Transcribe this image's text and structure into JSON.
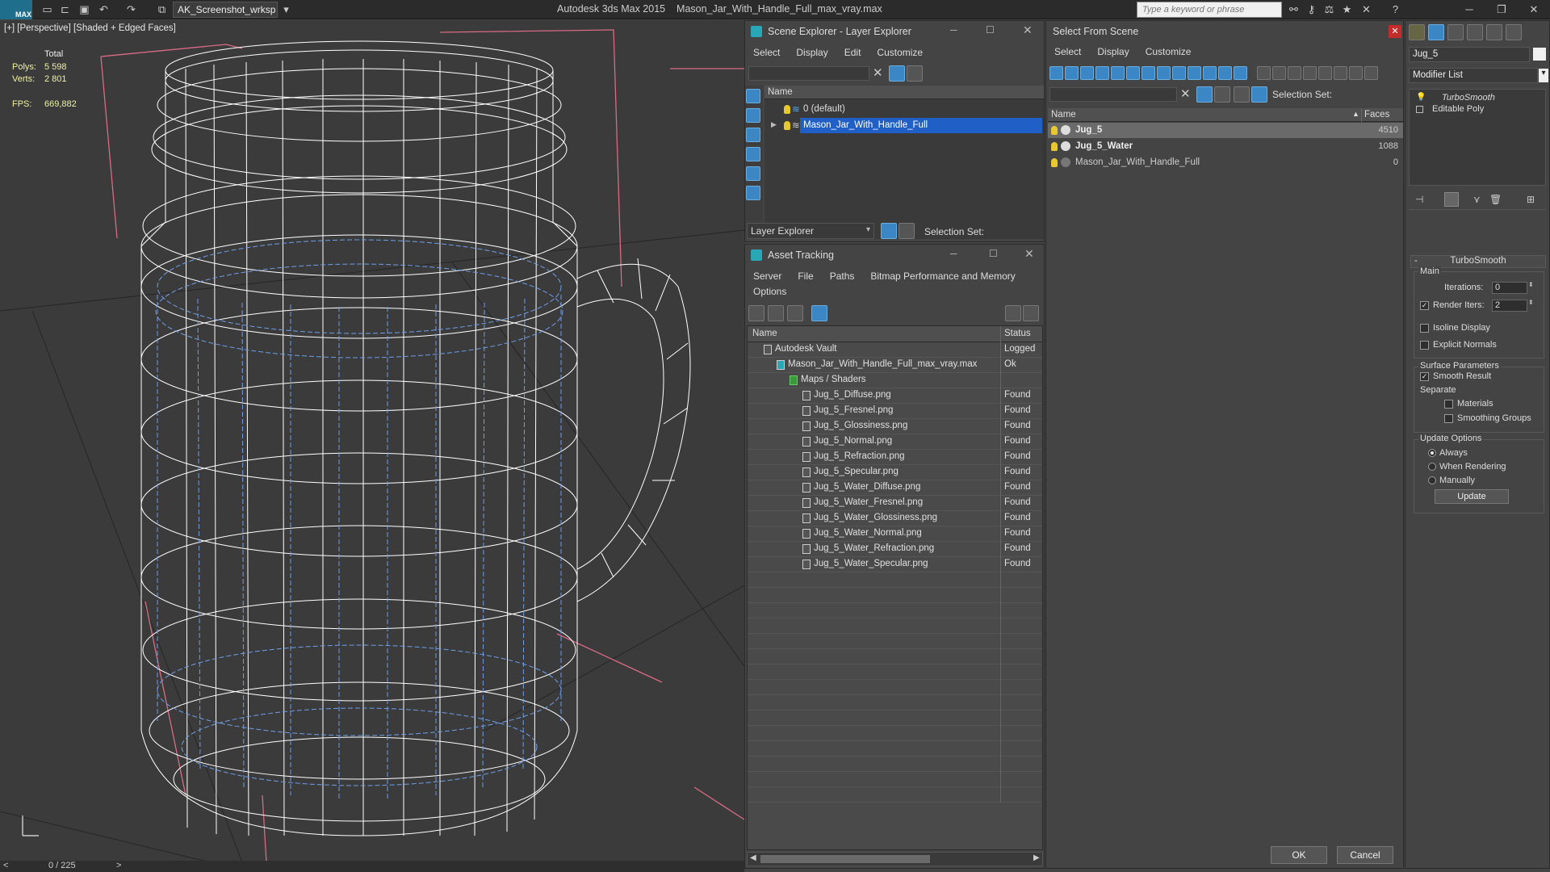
{
  "titlebar": {
    "logo": "MAX",
    "workspace": "AK_Screenshot_wrksp",
    "app": "Autodesk 3ds Max  2015",
    "file": "Mason_Jar_With_Handle_Full_max_vray.max",
    "search_placeholder": "Type a keyword or phrase"
  },
  "viewport": {
    "label": "[+] [Perspective] [Shaded + Edged Faces]",
    "stats": {
      "total": "Total",
      "polys_label": "Polys:",
      "polys": "5 598",
      "verts_label": "Verts:",
      "verts": "2 801",
      "fps_label": "FPS:",
      "fps": "669,882"
    },
    "timeline": "0 / 225",
    "prev": "<",
    "next": ">"
  },
  "scene_explorer": {
    "title": "Scene Explorer - Layer Explorer",
    "menu": [
      "Select",
      "Display",
      "Edit",
      "Customize"
    ],
    "col_name": "Name",
    "layers": [
      {
        "name": "0 (default)",
        "selected": false
      },
      {
        "name": "Mason_Jar_With_Handle_Full",
        "selected": true
      }
    ],
    "footer_dropdown": "Layer Explorer",
    "selection_set": "Selection Set:"
  },
  "asset_tracking": {
    "title": "Asset Tracking",
    "menu": [
      "Server",
      "File",
      "Paths",
      "Bitmap Performance and Memory"
    ],
    "menu2": [
      "Options"
    ],
    "col_name": "Name",
    "col_status": "Status",
    "rows": [
      {
        "name": "Autodesk Vault",
        "status": "Logged",
        "indent": 0
      },
      {
        "name": "Mason_Jar_With_Handle_Full_max_vray.max",
        "status": "Ok",
        "indent": 1
      },
      {
        "name": "Maps / Shaders",
        "status": "",
        "indent": 2
      },
      {
        "name": "Jug_5_Diffuse.png",
        "status": "Found",
        "indent": 3
      },
      {
        "name": "Jug_5_Fresnel.png",
        "status": "Found",
        "indent": 3
      },
      {
        "name": "Jug_5_Glossiness.png",
        "status": "Found",
        "indent": 3
      },
      {
        "name": "Jug_5_Normal.png",
        "status": "Found",
        "indent": 3
      },
      {
        "name": "Jug_5_Refraction.png",
        "status": "Found",
        "indent": 3
      },
      {
        "name": "Jug_5_Specular.png",
        "status": "Found",
        "indent": 3
      },
      {
        "name": "Jug_5_Water_Diffuse.png",
        "status": "Found",
        "indent": 3
      },
      {
        "name": "Jug_5_Water_Fresnel.png",
        "status": "Found",
        "indent": 3
      },
      {
        "name": "Jug_5_Water_Glossiness.png",
        "status": "Found",
        "indent": 3
      },
      {
        "name": "Jug_5_Water_Normal.png",
        "status": "Found",
        "indent": 3
      },
      {
        "name": "Jug_5_Water_Refraction.png",
        "status": "Found",
        "indent": 3
      },
      {
        "name": "Jug_5_Water_Specular.png",
        "status": "Found",
        "indent": 3
      }
    ]
  },
  "select_from_scene": {
    "title": "Select From Scene",
    "menu": [
      "Select",
      "Display",
      "Customize"
    ],
    "selection_set": "Selection Set:",
    "col_name": "Name",
    "col_faces": "Faces",
    "objects": [
      {
        "name": "Jug_5",
        "faces": "4510",
        "bold": true,
        "selected": true
      },
      {
        "name": "Jug_5_Water",
        "faces": "1088",
        "bold": true,
        "selected": false
      },
      {
        "name": "Mason_Jar_With_Handle_Full",
        "faces": "0",
        "bold": false,
        "selected": false
      }
    ],
    "ok": "OK",
    "cancel": "Cancel"
  },
  "command_panel": {
    "object_name": "Jug_5",
    "modifier_list": "Modifier List",
    "stack": [
      "TurboSmooth",
      "Editable Poly"
    ],
    "rollout_title": "TurboSmooth",
    "main": "Main",
    "iterations_label": "Iterations:",
    "iterations": "0",
    "render_iters_label": "Render Iters:",
    "render_iters": "2",
    "isoline": "Isoline Display",
    "explicit_normals": "Explicit Normals",
    "surface_params": "Surface Parameters",
    "smooth_result": "Smooth Result",
    "separate": "Separate",
    "materials": "Materials",
    "smoothing_groups": "Smoothing Groups",
    "update_options": "Update Options",
    "always": "Always",
    "when_rendering": "When Rendering",
    "manually": "Manually",
    "update": "Update"
  }
}
